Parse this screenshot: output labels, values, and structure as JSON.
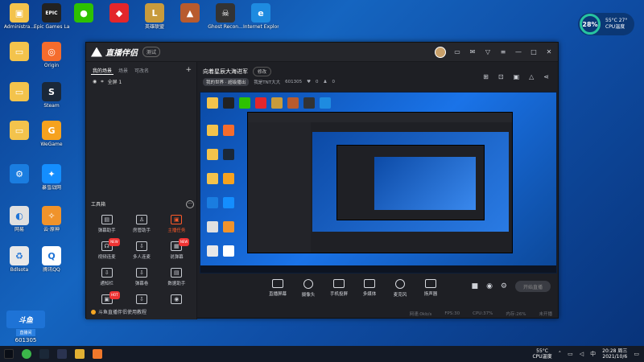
{
  "desktop": {
    "icons": [
      {
        "label": "Administra...",
        "glyph": "▣",
        "bg": "#f3c34c"
      },
      {
        "label": "Epic Games Launcher",
        "glyph": "EPIC",
        "bg": "#222"
      },
      {
        "label": "",
        "glyph": "●",
        "bg": "#2dc100"
      },
      {
        "label": "",
        "glyph": "◆",
        "bg": "#e3262b"
      },
      {
        "label": "英雄联盟",
        "glyph": "L",
        "bg": "#c89b3c"
      },
      {
        "label": "",
        "glyph": "▲",
        "bg": "#b85b2e"
      },
      {
        "label": "Ghost Recon...",
        "glyph": "☠",
        "bg": "#333"
      },
      {
        "label": "Internet Explorer",
        "glyph": "e",
        "bg": "#1e8be0"
      },
      {
        "label": "",
        "glyph": "▭",
        "bg": "#f3c34c"
      },
      {
        "label": "Origin",
        "glyph": "◎",
        "bg": "#f56c2d"
      },
      {
        "label": "",
        "glyph": "▭",
        "bg": "#f3c34c"
      },
      {
        "label": "Steam",
        "glyph": "S",
        "bg": "#1b2838"
      },
      {
        "label": "",
        "glyph": "▭",
        "bg": "#f3c34c"
      },
      {
        "label": "WeGame",
        "glyph": "G",
        "bg": "#f6a21e"
      },
      {
        "label": "",
        "glyph": "⚙",
        "bg": "#1a7de0"
      },
      {
        "label": "暴雪战网",
        "glyph": "✦",
        "bg": "#148eff"
      },
      {
        "label": "网易",
        "glyph": "◐",
        "bg": "#e0e0e0"
      },
      {
        "label": "云·原神",
        "glyph": "✧",
        "bg": "#f0932b"
      },
      {
        "label": "Bdlsota",
        "glyph": "♻",
        "bg": "#e8e8e8"
      },
      {
        "label": "腾讯QQ",
        "glyph": "Q",
        "bg": "#fff"
      }
    ]
  },
  "cpu": {
    "percent": "28%",
    "temp": "55°C 27°",
    "label": "CPU温度"
  },
  "app": {
    "brand": "直播伴侣",
    "version_badge": "测试",
    "tabs": [
      "我的场景",
      "场景",
      "可改名"
    ],
    "scene_label": "全屏 1",
    "room_title": "向着星辰大海进军",
    "edit_label": "修改",
    "room_meta": {
      "chip": "我的世界 · 超级播出",
      "host": "我是TNT大大",
      "id": "601305",
      "likes": "0",
      "fans": "0"
    },
    "tools_header": "工具箱",
    "tools": [
      {
        "name": "弹幕助手",
        "glyph": "▤",
        "hot": false,
        "badge": ""
      },
      {
        "name": "房管助手",
        "glyph": "♙",
        "hot": false,
        "badge": ""
      },
      {
        "name": "主播任务",
        "glyph": "▣",
        "hot": true,
        "badge": ""
      },
      {
        "name": "视频连麦",
        "glyph": "☊",
        "hot": false,
        "badge": "NEW"
      },
      {
        "name": "多人连麦",
        "glyph": "⇩",
        "hot": false,
        "badge": ""
      },
      {
        "name": "说弹幕",
        "glyph": "▦",
        "hot": false,
        "badge": "NEW"
      },
      {
        "name": "通知栏",
        "glyph": "⇩",
        "hot": false,
        "badge": ""
      },
      {
        "name": "弹幕卷",
        "glyph": "⇩",
        "hot": false,
        "badge": ""
      },
      {
        "name": "数据助手",
        "glyph": "▤",
        "hot": false,
        "badge": ""
      },
      {
        "name": "",
        "glyph": "▣",
        "hot": false,
        "badge": "HOT"
      },
      {
        "name": "",
        "glyph": "⇩",
        "hot": false,
        "badge": ""
      },
      {
        "name": "",
        "glyph": "◉",
        "hot": false,
        "badge": ""
      }
    ],
    "tip": "斗鱼直播伴侣使用教程",
    "controls": [
      {
        "name": "直播屏幕",
        "shape": "rect"
      },
      {
        "name": "摄像头",
        "shape": "round"
      },
      {
        "name": "手机投屏",
        "shape": "rect"
      },
      {
        "name": "多媒体",
        "shape": "rect"
      },
      {
        "name": "麦克风",
        "shape": "round"
      },
      {
        "name": "扬声器",
        "shape": "rect"
      }
    ],
    "live_button": "开始直播",
    "status": [
      "网速:0kb/s",
      "FPS:30",
      "CPU:37%",
      "内存:26%",
      "未开播"
    ]
  },
  "watermark": {
    "logo": "斗鱼",
    "sub": "直播间",
    "room": "601305"
  },
  "taskbar": {
    "temp": "55°C",
    "temp_label": "CPU温度",
    "time": "20:28 周三",
    "date": "2021/10/6"
  }
}
